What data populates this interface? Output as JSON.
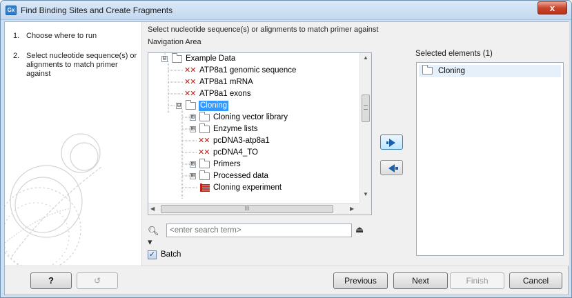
{
  "window": {
    "app_icon": "Gx",
    "title": "Find Binding Sites and Create Fragments",
    "close_glyph": "x"
  },
  "steps": [
    {
      "num": "1.",
      "label": "Choose where to run"
    },
    {
      "num": "2.",
      "label": "Select nucleotide sequence(s) or alignments to match primer against"
    }
  ],
  "instruction": "Select nucleotide sequence(s) or alignments to match primer against",
  "navigation_area": {
    "label": "Navigation Area",
    "tree": [
      {
        "label": "Example Data",
        "kind": "folder",
        "expander": "⊟",
        "level": 0
      },
      {
        "label": "ATP8a1 genomic sequence",
        "kind": "sequence",
        "level": 1
      },
      {
        "label": "ATP8a1 mRNA",
        "kind": "sequence",
        "level": 1
      },
      {
        "label": "ATP8a1 exons",
        "kind": "sequence",
        "level": 1
      },
      {
        "label": "Cloning",
        "kind": "folder",
        "expander": "⊟",
        "level": 1,
        "selected": true
      },
      {
        "label": "Cloning vector library",
        "kind": "folder",
        "expander": "⊞",
        "level": 2
      },
      {
        "label": "Enzyme lists",
        "kind": "folder",
        "expander": "⊞",
        "level": 2
      },
      {
        "label": "pcDNA3-atp8a1",
        "kind": "sequence",
        "level": 2
      },
      {
        "label": "pcDNA4_TO",
        "kind": "sequence",
        "level": 2
      },
      {
        "label": "Primers",
        "kind": "folder",
        "expander": "⊞",
        "level": 2
      },
      {
        "label": "Processed data",
        "kind": "folder",
        "expander": "⊞",
        "level": 2
      },
      {
        "label": "Cloning experiment",
        "kind": "experiment",
        "level": 2
      }
    ],
    "hscroll_grip": "III"
  },
  "search": {
    "placeholder": "<enter search term>",
    "icon": "search-icon",
    "eject_icon": "eject-icon"
  },
  "batch": {
    "label": "Batch",
    "checked": true,
    "check_glyph": "✓"
  },
  "selected": {
    "label": "Selected elements (1)",
    "items": [
      {
        "label": "Cloning",
        "kind": "folder"
      }
    ]
  },
  "buttons": {
    "help": "?",
    "restore": "↺",
    "previous": "Previous",
    "next": "Next",
    "finish": "Finish",
    "cancel": "Cancel"
  },
  "colors": {
    "accent": "#1b5faa",
    "sequence_icon": "#c0201a",
    "selection": "#3399ff"
  }
}
